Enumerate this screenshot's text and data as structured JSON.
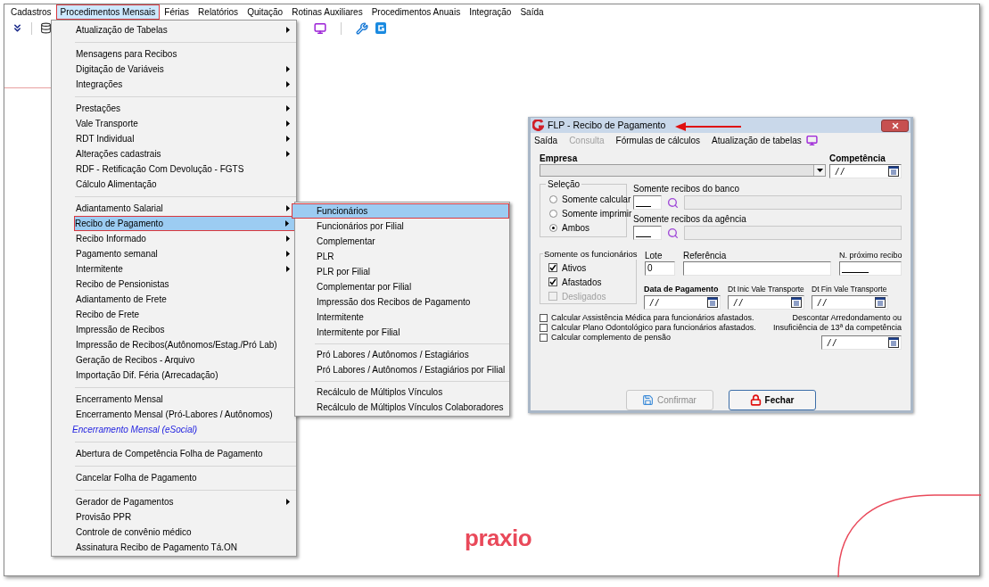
{
  "menubar": [
    {
      "label": "Cadastros",
      "selected": false
    },
    {
      "label": "Procedimentos Mensais",
      "selected": true
    },
    {
      "label": "Férias",
      "selected": false
    },
    {
      "label": "Relatórios",
      "selected": false
    },
    {
      "label": "Quitação",
      "selected": false
    },
    {
      "label": "Rotinas Auxiliares",
      "selected": false
    },
    {
      "label": "Procedimentos Anuais",
      "selected": false
    },
    {
      "label": "Integração",
      "selected": false
    },
    {
      "label": "Saída",
      "selected": false
    }
  ],
  "menu": {
    "groups": [
      [
        {
          "label": "Atualização de Tabelas",
          "kind": "normal",
          "submenu": true,
          "selected": false
        }
      ],
      [
        {
          "label": "Mensagens para Recibos",
          "kind": "normal",
          "submenu": false,
          "selected": false
        },
        {
          "label": "Digitação de Variáveis",
          "kind": "normal",
          "submenu": true,
          "selected": false
        },
        {
          "label": "Integrações",
          "kind": "normal",
          "submenu": true,
          "selected": false
        }
      ],
      [
        {
          "label": "Prestações",
          "kind": "normal",
          "submenu": true,
          "selected": false
        },
        {
          "label": "Vale Transporte",
          "kind": "normal",
          "submenu": true,
          "selected": false
        },
        {
          "label": "RDT Individual",
          "kind": "normal",
          "submenu": true,
          "selected": false
        },
        {
          "label": "Alterações cadastrais",
          "kind": "normal",
          "submenu": true,
          "selected": false
        },
        {
          "label": "RDF - Retificação Com Devolução - FGTS",
          "kind": "normal",
          "submenu": false,
          "selected": false
        },
        {
          "label": "Cálculo Alimentação",
          "kind": "normal",
          "submenu": false,
          "selected": false
        }
      ],
      [
        {
          "label": "Adiantamento Salarial",
          "kind": "normal",
          "submenu": true,
          "selected": false
        },
        {
          "label": "Recibo de Pagamento",
          "kind": "normal",
          "submenu": true,
          "selected": true
        },
        {
          "label": "Recibo Informado",
          "kind": "normal",
          "submenu": true,
          "selected": false
        },
        {
          "label": "Pagamento semanal",
          "kind": "normal",
          "submenu": true,
          "selected": false
        },
        {
          "label": "Intermitente",
          "kind": "normal",
          "submenu": true,
          "selected": false
        },
        {
          "label": "Recibo de Pensionistas",
          "kind": "normal",
          "submenu": false,
          "selected": false
        },
        {
          "label": "Adiantamento de Frete",
          "kind": "normal",
          "submenu": false,
          "selected": false
        },
        {
          "label": "Recibo de Frete",
          "kind": "normal",
          "submenu": false,
          "selected": false
        },
        {
          "label": "Impressão de Recibos",
          "kind": "normal",
          "submenu": false,
          "selected": false
        },
        {
          "label": "Impressão de Recibos(Autônomos/Estag./Pró Lab)",
          "kind": "normal",
          "submenu": false,
          "selected": false
        },
        {
          "label": "Geração de Recibos - Arquivo",
          "kind": "normal",
          "submenu": false,
          "selected": false
        },
        {
          "label": "Importação Dif. Féria (Arrecadação)",
          "kind": "normal",
          "submenu": false,
          "selected": false
        }
      ],
      [
        {
          "label": "Encerramento Mensal",
          "kind": "normal",
          "submenu": false,
          "selected": false
        },
        {
          "label": "Encerramento Mensal (Pró-Labores / Autônomos)",
          "kind": "normal",
          "submenu": false,
          "selected": false
        },
        {
          "label": "Encerramento Mensal (eSocial)",
          "kind": "emphasis",
          "submenu": false,
          "selected": false
        }
      ],
      [
        {
          "label": "Abertura de Competência Folha de Pagamento",
          "kind": "normal",
          "submenu": false,
          "selected": false
        }
      ],
      [
        {
          "label": "Cancelar Folha de Pagamento",
          "kind": "normal",
          "submenu": false,
          "selected": false
        }
      ],
      [
        {
          "label": "Gerador de Pagamentos",
          "kind": "normal",
          "submenu": true,
          "selected": false
        },
        {
          "label": "Provisão PPR",
          "kind": "normal",
          "submenu": false,
          "selected": false
        },
        {
          "label": "Controle de convênio médico",
          "kind": "normal",
          "submenu": false,
          "selected": false
        },
        {
          "label": "Assinatura Recibo de Pagamento Tá.ON",
          "kind": "normal",
          "submenu": false,
          "selected": false
        }
      ]
    ]
  },
  "submenu": {
    "groups": [
      [
        {
          "label": "Funcionários",
          "selected": true
        },
        {
          "label": "Funcionários por Filial",
          "selected": false
        },
        {
          "label": "Complementar",
          "selected": false
        },
        {
          "label": "PLR",
          "selected": false
        },
        {
          "label": "PLR por Filial",
          "selected": false
        },
        {
          "label": "Complementar por Filial",
          "selected": false
        },
        {
          "label": "Impressão dos Recibos de Pagamento",
          "selected": false
        },
        {
          "label": "Intermitente",
          "selected": false
        },
        {
          "label": "Intermitente por Filial",
          "selected": false
        }
      ],
      [
        {
          "label": "Pró Labores / Autônomos / Estagiários",
          "selected": false
        },
        {
          "label": "Pró Labores / Autônomos / Estagiários por Filial",
          "selected": false
        }
      ],
      [
        {
          "label": "Recálculo de Múltiplos Vínculos",
          "selected": false
        },
        {
          "label": "Recálculo de Múltiplos Vínculos Colaboradores",
          "selected": false
        }
      ]
    ]
  },
  "dialog": {
    "title": "FLP - Recibo de Pagamento",
    "menu": [
      {
        "label": "Saída",
        "disabled": false
      },
      {
        "label": "Consulta",
        "disabled": true
      },
      {
        "label": "Fórmulas de cálculos",
        "disabled": false
      },
      {
        "label": "Atualização de tabelas",
        "disabled": false
      }
    ],
    "empresa": {
      "label": "Empresa"
    },
    "competencia": {
      "label": "Competência",
      "value": "/ /"
    },
    "selecao": {
      "label": "Seleção",
      "options": [
        {
          "label": "Somente calcular",
          "selected": false
        },
        {
          "label": "Somente imprimir",
          "selected": false
        },
        {
          "label": "Ambos",
          "selected": true
        }
      ]
    },
    "banco": {
      "label": "Somente recibos do banco"
    },
    "agencia": {
      "label": "Somente recibos da agência"
    },
    "funcionarios": {
      "label": "Somente os funcionários",
      "options": [
        {
          "label": "Ativos",
          "checked": true,
          "disabled": false
        },
        {
          "label": "Afastados",
          "checked": true,
          "disabled": false
        },
        {
          "label": "Desligados",
          "checked": false,
          "disabled": true
        }
      ]
    },
    "lote": {
      "label": "Lote",
      "value": "0"
    },
    "referencia": {
      "label": "Referência"
    },
    "proximo_recibo": {
      "label": "N. próximo recibo"
    },
    "dates": [
      {
        "label": "Data de Pagamento",
        "value": "/ /",
        "bold": true
      },
      {
        "label": "Dt Inic Vale Transporte",
        "value": "/ /",
        "bold": false
      },
      {
        "label": "Dt Fin Vale Transporte",
        "value": "/ /",
        "bold": false
      }
    ],
    "options": [
      {
        "label": "Calcular Assistência Médica para funcionários afastados.",
        "checked": false
      },
      {
        "label": "Calcular Plano Odontológico para funcionários afastados.",
        "checked": false
      },
      {
        "label": "Calcular complemento de pensão",
        "checked": false
      }
    ],
    "descontar": {
      "lines": [
        "Descontar Arredondamento ou",
        "Insuficiência de 13ª da competência"
      ],
      "value": "/ /"
    },
    "buttons": [
      {
        "label": "Confirmar",
        "kind": "save",
        "disabled": true
      },
      {
        "label": "Fechar",
        "kind": "lock",
        "disabled": false
      }
    ]
  },
  "logo": "praxio"
}
